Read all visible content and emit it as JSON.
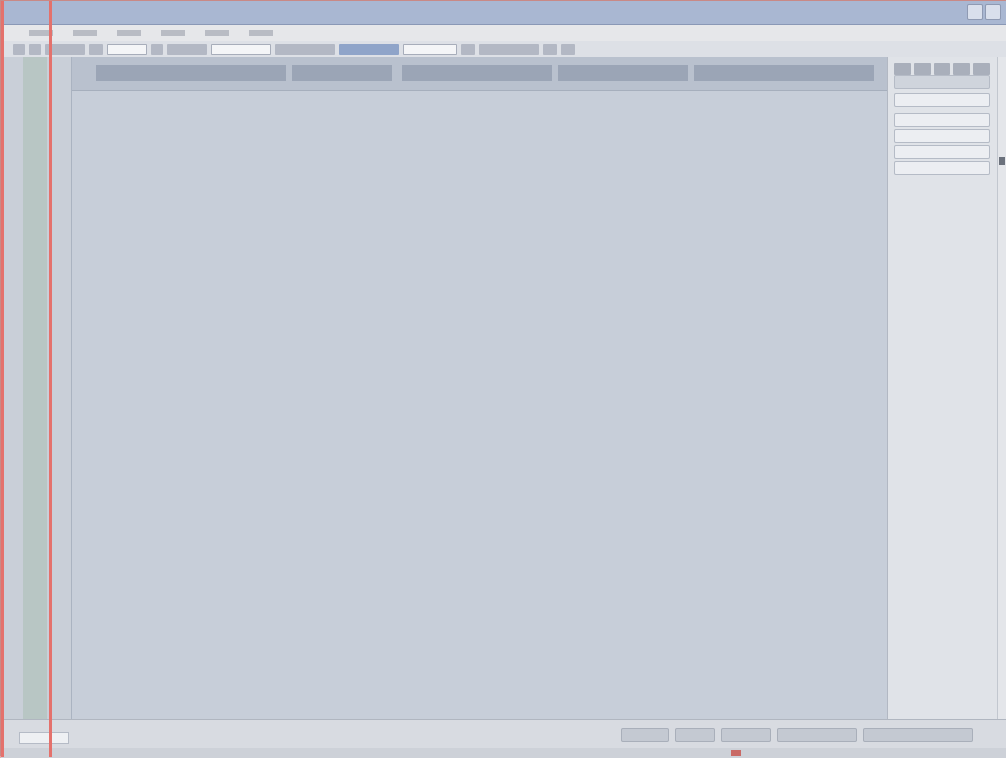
{
  "window": {
    "title": ""
  },
  "menu": {
    "items": [
      "",
      "",
      "",
      "",
      "",
      ""
    ]
  },
  "toolbar": {
    "search_value": ""
  },
  "sheet": {
    "tabs": [
      "",
      "",
      "",
      "",
      ""
    ]
  },
  "panel": {
    "rows": [
      "",
      "",
      "",
      ""
    ],
    "field_value": ""
  },
  "status": {
    "left_value": "",
    "segments": [
      "",
      "",
      "",
      "",
      ""
    ],
    "message": ""
  },
  "colors": {
    "titlebar": "#a9b7d2",
    "accent_stripe": "#e4716c",
    "sheet_bg": "#c7ced9",
    "panel_bg": "#e0e3e8"
  }
}
